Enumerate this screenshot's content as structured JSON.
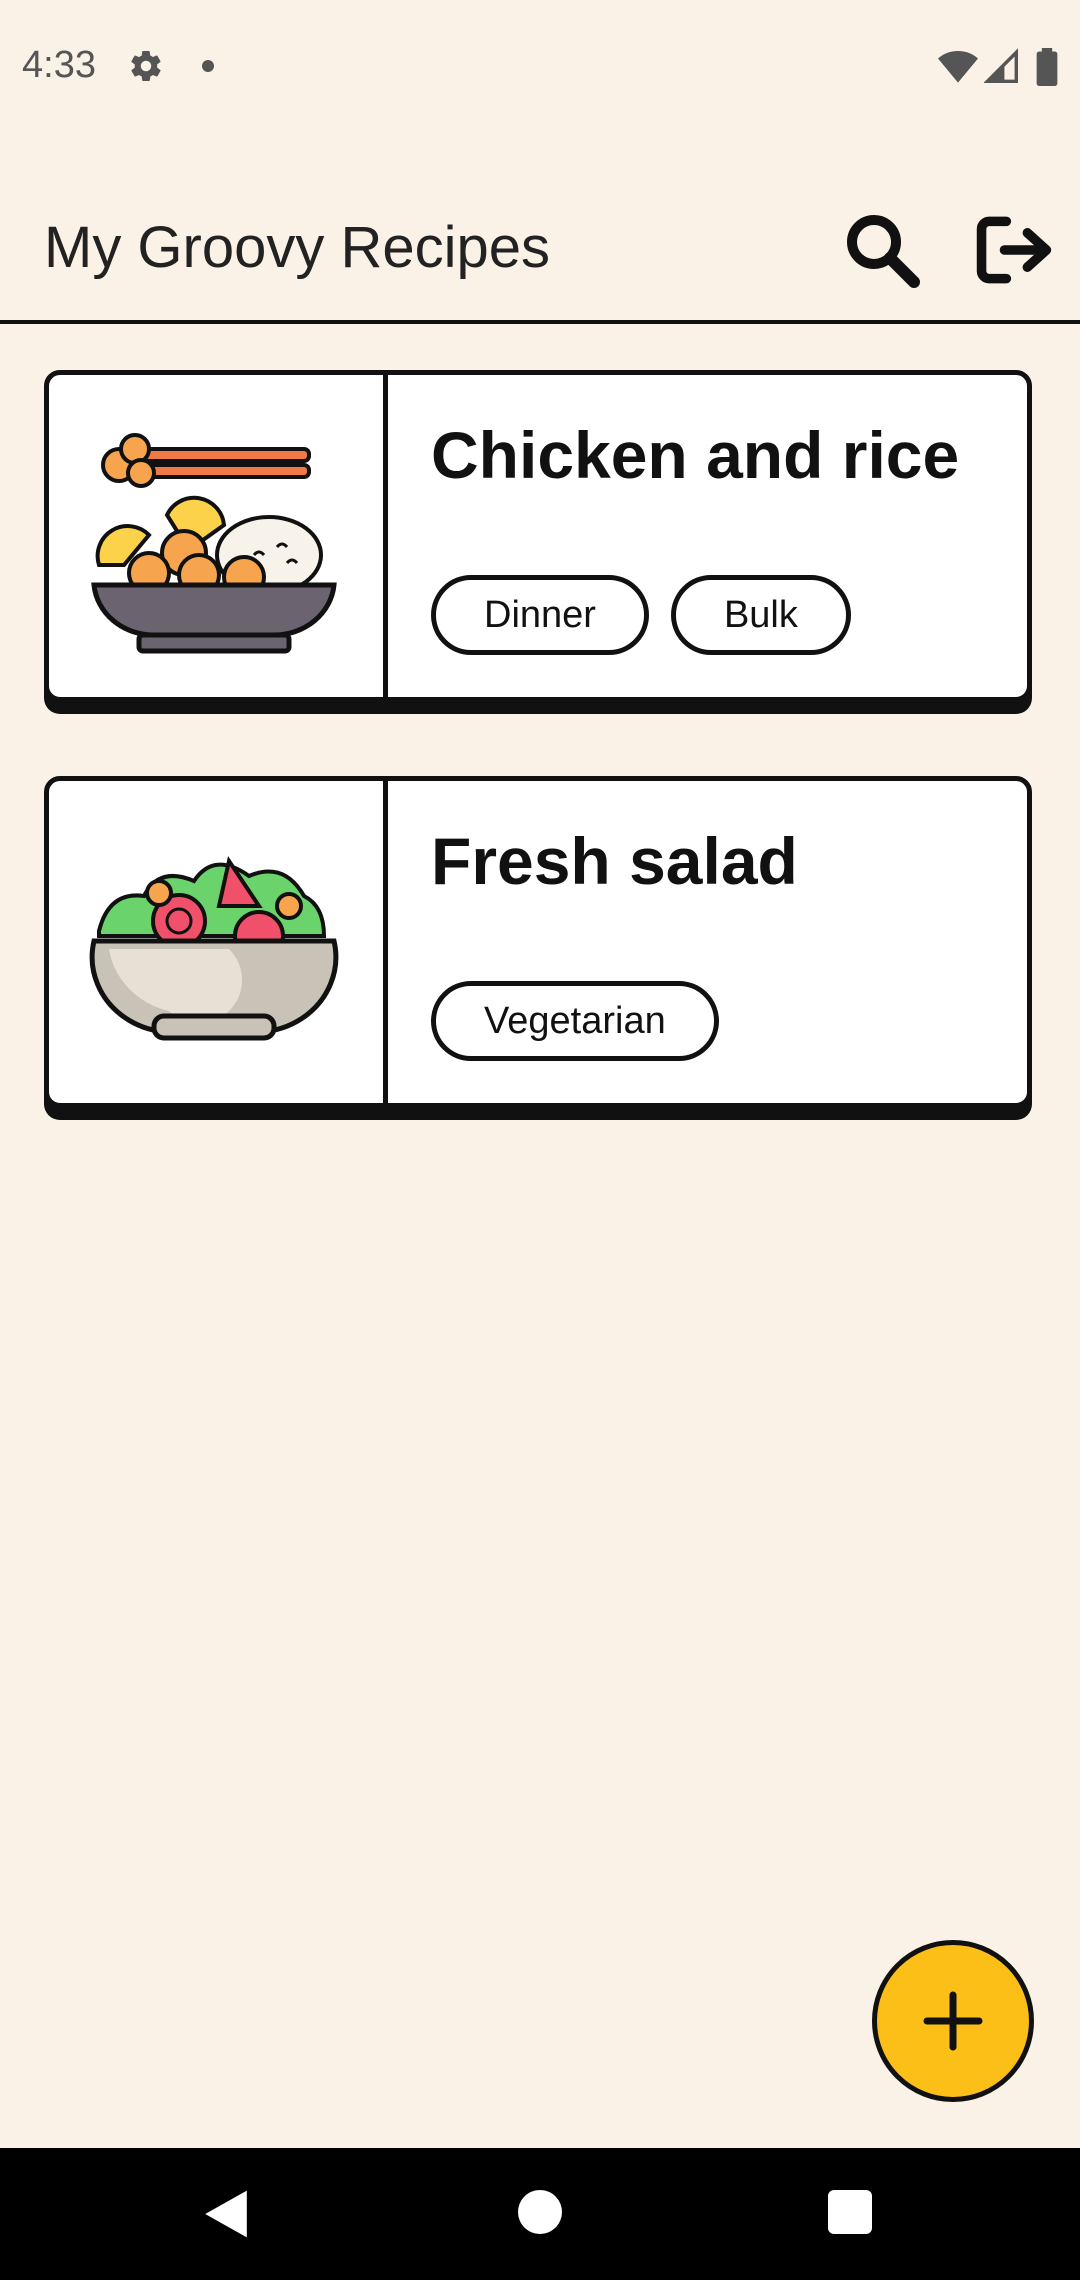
{
  "status_bar": {
    "time": "4:33"
  },
  "app_bar": {
    "title": "My Groovy Recipes",
    "icons": [
      "search-icon",
      "logout-icon"
    ]
  },
  "recipes": [
    {
      "title": "Chicken and rice",
      "image_icon": "chicken-rice-bowl-icon",
      "tags": [
        "Dinner",
        "Bulk"
      ]
    },
    {
      "title": "Fresh salad",
      "image_icon": "salad-bowl-icon",
      "tags": [
        "Vegetarian"
      ]
    }
  ],
  "fab": {
    "icon": "plus-icon",
    "color": "#fbbf18"
  },
  "colors": {
    "background": "#fbf2e7",
    "card": "#ffffff",
    "outline": "#111111"
  },
  "nav_bar": {
    "icons": [
      "back-icon",
      "home-icon",
      "recents-icon"
    ]
  }
}
